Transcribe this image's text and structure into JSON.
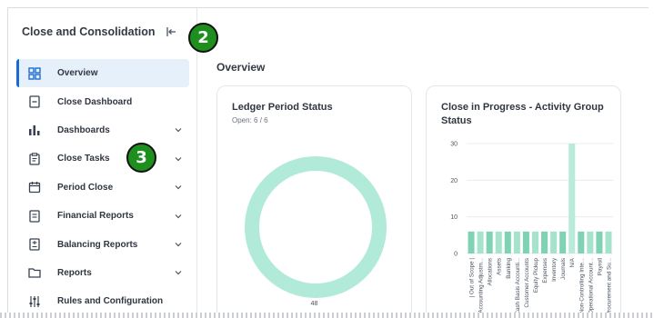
{
  "sidebar": {
    "title": "Close and Consolidation",
    "items": [
      {
        "label": "Overview",
        "icon": "grid-icon",
        "active": true,
        "expandable": false
      },
      {
        "label": "Close Dashboard",
        "icon": "dashboard-doc-icon",
        "active": false,
        "expandable": false
      },
      {
        "label": "Dashboards",
        "icon": "bar-chart-icon",
        "active": false,
        "expandable": true
      },
      {
        "label": "Close Tasks",
        "icon": "clipboard-icon",
        "active": false,
        "expandable": true
      },
      {
        "label": "Period Close",
        "icon": "calendar-icon",
        "active": false,
        "expandable": true
      },
      {
        "label": "Financial Reports",
        "icon": "report-icon",
        "active": false,
        "expandable": true
      },
      {
        "label": "Balancing Reports",
        "icon": "balance-report-icon",
        "active": false,
        "expandable": true
      },
      {
        "label": "Reports",
        "icon": "folder-icon",
        "active": false,
        "expandable": true
      },
      {
        "label": "Rules and Configuration",
        "icon": "sliders-icon",
        "active": false,
        "expandable": false
      }
    ]
  },
  "annotations": {
    "badge_a": "2",
    "badge_b": "3"
  },
  "main": {
    "title": "Overview",
    "cards": [
      {
        "title": "Ledger Period Status",
        "subtitle": "Open: 6 / 6",
        "donut_label": "48"
      },
      {
        "title": "Close in Progress - Activity Group Status"
      }
    ]
  },
  "colors": {
    "accent": "#1a6bd1",
    "donut": "#b2ead9",
    "bar": "#7fd3b4",
    "bar_light": "#b8ebd9",
    "badge": "#1e8f1e"
  },
  "chart_data": [
    {
      "type": "pie",
      "title": "Ledger Period Status",
      "subtitle": "Open: 6 / 6",
      "values": [
        48
      ],
      "labels": [
        "48"
      ]
    },
    {
      "type": "bar",
      "title": "Close in Progress - Activity Group Status",
      "ylim": [
        0,
        30
      ],
      "yticks": [
        0,
        10,
        20,
        30
      ],
      "categories": [
        "(Out of Scope)",
        "Accounting Adjustm...",
        "Allocations",
        "Assets",
        "Banking",
        "Cash Basis Accounti...",
        "Customer Accounts",
        "Equity Pickup",
        "Expenses",
        "Inventory",
        "Journals",
        "N/A",
        "Non-Controlling Inte...",
        "Operational Account...",
        "Payroll",
        "Procurement and Su..."
      ],
      "values": [
        6,
        6,
        6,
        6,
        6,
        6,
        6,
        6,
        6,
        6,
        6,
        30,
        6,
        6,
        6,
        6
      ],
      "tick_labels": [
        "| Out of Scope |",
        "Accounting Adjustm...",
        "Allocations",
        "Assets",
        "Banking",
        "Cash Basis Accounti...",
        "Customer Accounts",
        "Equity Pickup",
        "Expenses",
        "Inventory",
        "Journals",
        "N/A",
        "Non-Controlling Inte...",
        "Operational Account...",
        "Payroll",
        "Procurement and Su..."
      ]
    }
  ]
}
